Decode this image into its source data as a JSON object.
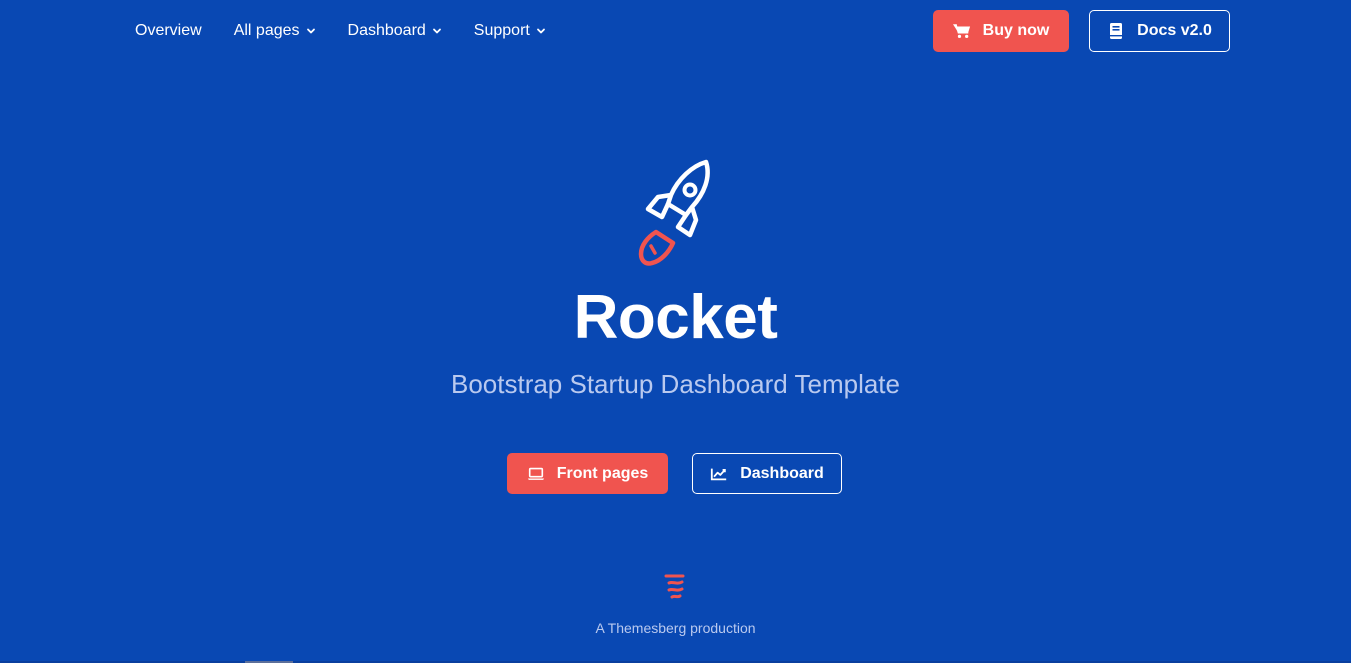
{
  "nav": {
    "links": [
      {
        "label": "Overview"
      },
      {
        "label": "All pages"
      },
      {
        "label": "Dashboard"
      },
      {
        "label": "Support"
      }
    ],
    "buy_label": "Buy now",
    "docs_label": "Docs v2.0"
  },
  "hero": {
    "title": "Rocket",
    "subtitle": "Bootstrap Startup Dashboard Template",
    "front_pages_label": "Front pages",
    "dashboard_label": "Dashboard"
  },
  "footer": {
    "production": "A Themesberg production"
  },
  "colors": {
    "background": "#0948b3",
    "accent": "#f0544f",
    "subtitle": "#b9c9ef"
  },
  "icons": {
    "buy": "cart-icon",
    "docs": "book-icon",
    "front_pages": "laptop-icon",
    "dashboard": "chart-line-icon",
    "logo": "rocket-icon",
    "brand": "themesberg-logo-icon"
  }
}
